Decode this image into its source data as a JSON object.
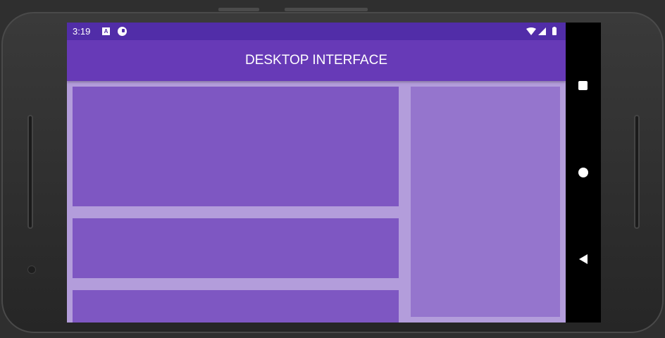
{
  "status_bar": {
    "time": "3:19",
    "notification_icons": [
      "keyboard-a-icon",
      "app-circle-icon"
    ],
    "system_icons": [
      "wifi-icon",
      "cellular-signal-icon",
      "battery-icon"
    ]
  },
  "app_bar": {
    "title": "DESKTOP INTERFACE"
  },
  "colors": {
    "status_bar": "#512da8",
    "app_bar": "#673ab7",
    "content_background": "#b39ddb",
    "panel_main": "#7e57c2",
    "panel_side": "#9575cd",
    "nav_bar": "#000000"
  },
  "navigation_bar": {
    "buttons": [
      "recents-square-icon",
      "home-circle-icon",
      "back-triangle-icon"
    ]
  }
}
